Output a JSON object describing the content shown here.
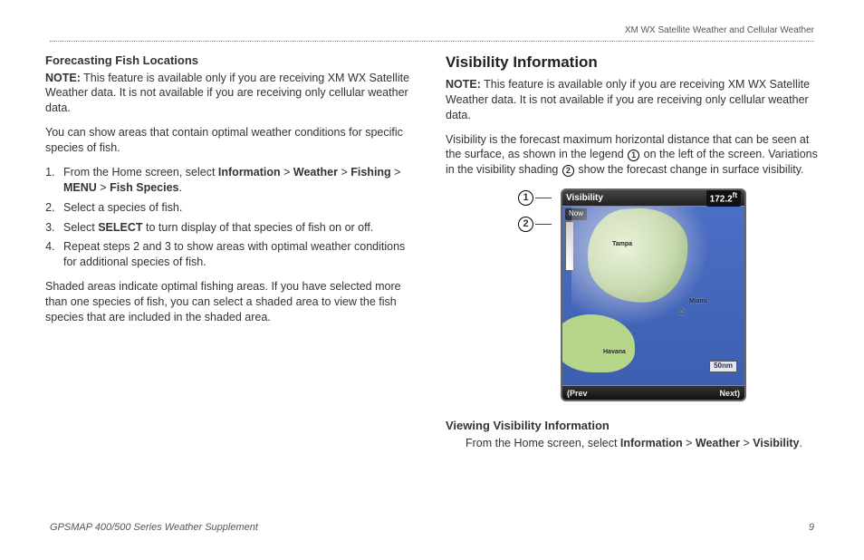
{
  "header": "XM WX Satellite Weather and Cellular Weather",
  "left": {
    "title": "Forecasting Fish Locations",
    "note_label": "NOTE:",
    "note_text": " This feature is available only if you are receiving XM WX Satellite Weather data. It is not available if you are receiving only cellular weather data.",
    "para1": "You can show areas that contain optimal weather conditions for specific species of fish.",
    "step1_pre": "From the Home screen, select ",
    "nav_info": "Information",
    "nav_weather": "Weather",
    "nav_fishing": "Fishing",
    "nav_menu": "MENU",
    "nav_species": "Fish Species",
    "step2": "Select a species of fish.",
    "step3_pre": "Select ",
    "step3_bold": "SELECT",
    "step3_post": " to turn display of that species of fish on or off.",
    "step4": "Repeat steps 2 and 3 to show areas with optimal weather conditions for additional species of fish.",
    "para2": "Shaded areas indicate optimal fishing areas. If you have selected more than one species of fish, you can select a shaded area to view the fish species that are included in the shaded area."
  },
  "right": {
    "heading": "Visibility Information",
    "note_label": "NOTE:",
    "note_text": " This feature is available only if you are receiving XM WX Satellite Weather data. It is not available if you are receiving only cellular weather data.",
    "para1_a": "Visibility is the forecast maximum horizontal distance that can be seen at the surface, as shown in the legend ",
    "para1_b": " on the left of the screen. Variations in the visibility shading ",
    "para1_c": " show the forecast change in surface visibility.",
    "callout1": "➀",
    "callout2": "➁",
    "sub": "Viewing Visibility Information",
    "vv_pre": "From the Home screen, select ",
    "vv_info": "Information",
    "vv_weather": "Weather",
    "vv_vis": "Visibility"
  },
  "map": {
    "title": "Visibility",
    "value": "172.2",
    "unit": "ft",
    "now": "Now",
    "tampa": "Tampa",
    "miami": "Miami",
    "havana": "Havana",
    "scale": "50nm",
    "prev": "(Prev",
    "next": "Next)"
  },
  "footer": {
    "left": "GPSMAP 400/500 Series Weather Supplement",
    "page": "9"
  }
}
